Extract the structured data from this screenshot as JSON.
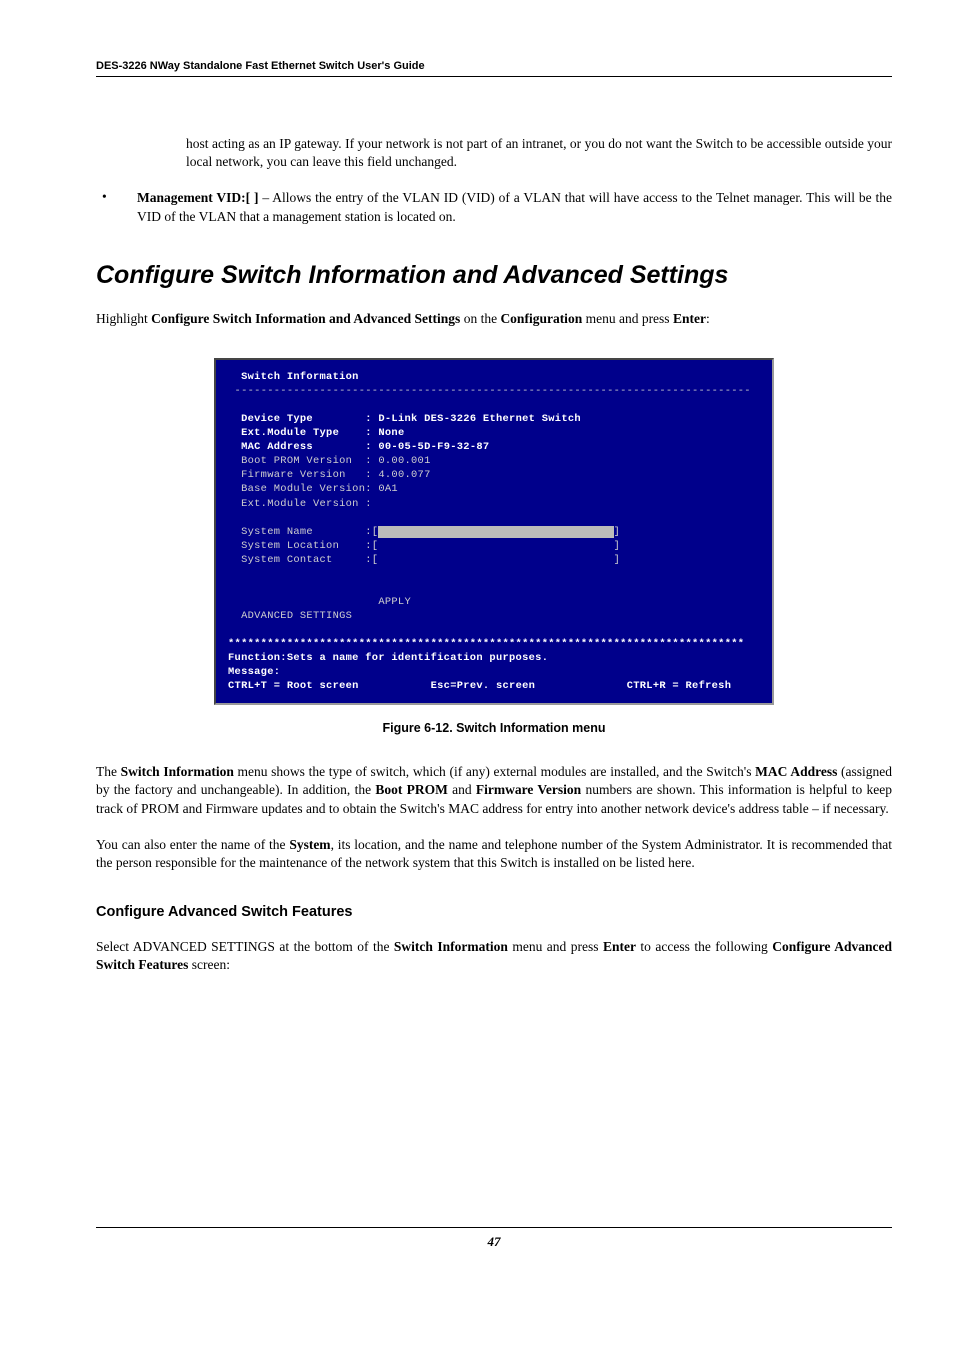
{
  "header": "DES-3226 NWay Standalone Fast Ethernet Switch User's Guide",
  "para1": "host acting as an IP gateway. If your network is not part of an intranet, or you do not want the Switch to be accessible outside your local network, you can leave this field unchanged.",
  "bullet": {
    "label": "Management VID:[   ]",
    "rest": " – Allows the entry of the VLAN ID (VID) of a VLAN that will have access to the Telnet manager. This will be the VID of the VLAN that a management station is located on."
  },
  "h2": "Configure Switch Information and Advanced Settings",
  "para2_pre": "Highlight ",
  "para2_b1": "Configure Switch Information and Advanced Settings",
  "para2_mid": " on the ",
  "para2_b2": "Configuration",
  "para2_mid2": " menu and press ",
  "para2_b3": "Enter",
  "para2_post": ":",
  "terminal": {
    "title": "Switch Information",
    "hr": "-------------------------------------------------------------------------------",
    "rows": [
      {
        "label": "Device Type        ",
        "value": ": D-Link DES-3226 Ethernet Switch",
        "bold": true
      },
      {
        "label": "Ext.Module Type    ",
        "value": ": None",
        "bold": true
      },
      {
        "label": "MAC Address        ",
        "value": ": 00-05-5D-F9-32-87",
        "bold": true
      },
      {
        "label": "Boot PROM Version  ",
        "value": ": 0.00.001"
      },
      {
        "label": "Firmware Version   ",
        "value": ": 4.00.077"
      },
      {
        "label": "Base Module Version",
        "value": ": 0A1"
      },
      {
        "label": "Ext.Module Version ",
        "value": ":"
      }
    ],
    "inputs": [
      {
        "label": "System Name        ",
        "open": ":[",
        "close": "]"
      },
      {
        "label": "System Location    ",
        "open": ":[",
        "close": "]"
      },
      {
        "label": "System Contact     ",
        "open": ":[",
        "close": "]"
      }
    ],
    "apply": "APPLY",
    "advanced": "ADVANCED SETTINGS",
    "stars": "*******************************************************************************",
    "fn": "Function:Sets a name for identification purposes.",
    "msg": "Message:",
    "help": {
      "l": "CTRL+T = Root screen",
      "m": "Esc=Prev. screen",
      "r": "CTRL+R = Refresh"
    }
  },
  "caption": "Figure 6-12.  Switch Information menu",
  "para3_a": "The ",
  "para3_b1": "Switch Information",
  "para3_b": " menu shows the type of switch, which (if any) external modules are installed, and the Switch's ",
  "para3_b2": "MAC Address",
  "para3_c": " (assigned by the factory and unchangeable). In addition, the ",
  "para3_b3": "Boot PROM",
  "para3_d": " and ",
  "para3_b4": "Firmware Version",
  "para3_e": " numbers are shown. This information is helpful to keep track of PROM and Firmware updates and to obtain the Switch's MAC address for entry into another network device's address table – if necessary.",
  "para4_a": "You can also enter the name of the ",
  "para4_b1": "System",
  "para4_b": ", its location, and the name and telephone number of the System Administrator. It is recommended that the person responsible for the maintenance of the network system that this Switch is installed on be listed here.",
  "h3": "Configure Advanced Switch Features",
  "para5_a": "Select ADVANCED SETTINGS at the bottom of the ",
  "para5_b1": "Switch Information",
  "para5_b": " menu and press ",
  "para5_b2": "Enter",
  "para5_c": " to access the following ",
  "para5_b3": "Configure Advanced Switch Features",
  "para5_d": " screen:",
  "pagenum": "47"
}
